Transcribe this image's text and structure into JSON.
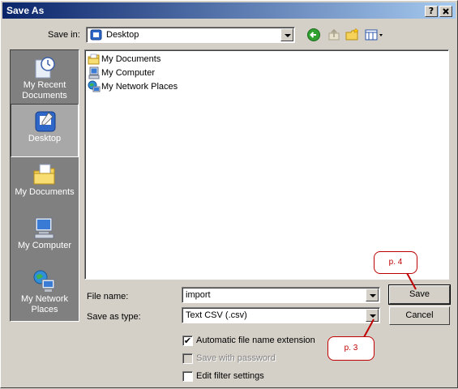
{
  "window": {
    "title": "Save As",
    "help_btn": "?",
    "close_btn": "X"
  },
  "toolbar": {
    "save_in_label": "Save in:",
    "save_in_value": "Desktop",
    "tools": [
      "back-icon",
      "up-folder-icon",
      "new-folder-icon",
      "view-menu-icon"
    ]
  },
  "places": [
    {
      "label": "My Recent Documents",
      "icon": "recent-documents-icon",
      "selected": false
    },
    {
      "label": "Desktop",
      "icon": "desktop-icon",
      "selected": true
    },
    {
      "label": "My Documents",
      "icon": "my-documents-icon",
      "selected": false
    },
    {
      "label": "My Computer",
      "icon": "my-computer-icon",
      "selected": false
    },
    {
      "label": "My Network Places",
      "icon": "network-places-icon",
      "selected": false
    }
  ],
  "files": [
    {
      "name": "My Documents",
      "icon": "folder-icon"
    },
    {
      "name": "My Computer",
      "icon": "computer-icon"
    },
    {
      "name": "My Network Places",
      "icon": "network-icon"
    }
  ],
  "form": {
    "file_name_label": "File name:",
    "file_name_value": "import",
    "save_type_label": "Save as type:",
    "save_type_value": "Text CSV (.csv)"
  },
  "buttons": {
    "save": "Save",
    "cancel": "Cancel"
  },
  "options": {
    "auto_ext": {
      "label": "Automatic file name extension",
      "checked": true,
      "enabled": true
    },
    "password": {
      "label": "Save with password",
      "checked": false,
      "enabled": false
    },
    "filter": {
      "label": "Edit filter settings",
      "checked": false,
      "enabled": true
    }
  },
  "annotations": {
    "p4": "p. 4",
    "p3": "p. 3"
  },
  "colors": {
    "title_bar": "#0a246a",
    "callout": "#c00000",
    "dialog_bg": "#d4d0c8"
  }
}
